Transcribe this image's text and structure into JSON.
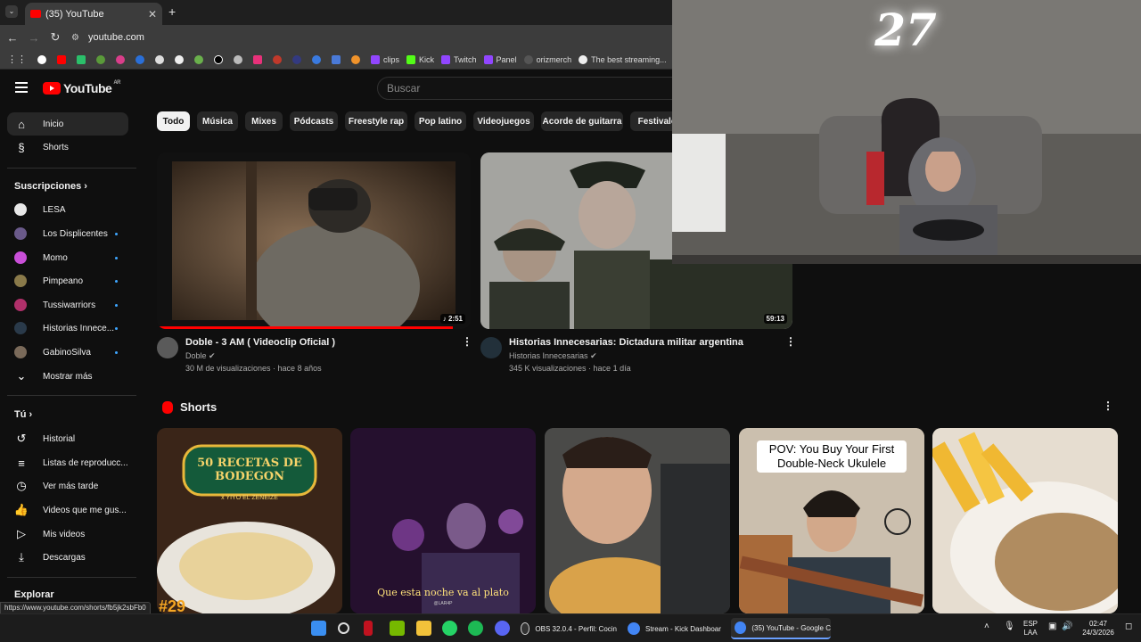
{
  "browser": {
    "tab_title": "(35) YouTube",
    "url": "youtube.com",
    "bookmarks": [
      "clips",
      "Kick",
      "Twitch",
      "Panel",
      "orizmerch",
      "The best streaming..."
    ]
  },
  "youtube": {
    "logo_text": "YouTube",
    "region": "AR",
    "search_placeholder": "Buscar",
    "chips": [
      "Todo",
      "Música",
      "Mixes",
      "Pódcasts",
      "Freestyle rap",
      "Pop latino",
      "Videojuegos",
      "Acorde de guitarra",
      "Festivale"
    ],
    "sidebar": {
      "main": [
        {
          "label": "Inicio",
          "icon": "home-icon"
        },
        {
          "label": "Shorts",
          "icon": "shorts-icon"
        }
      ],
      "subs_title": "Suscripciones",
      "subs": [
        {
          "label": "LESA",
          "color": "#e8e8e8",
          "dot": false
        },
        {
          "label": "Los Displicentes",
          "color": "#6a5a8a",
          "dot": true
        },
        {
          "label": "Momo",
          "color": "#c94fd8",
          "dot": true
        },
        {
          "label": "Pimpeano",
          "color": "#8a7a4a",
          "dot": true
        },
        {
          "label": "Tussiwarriors",
          "color": "#b0306a",
          "dot": true
        },
        {
          "label": "Historias Innece...",
          "color": "#2a3a4a",
          "dot": true
        },
        {
          "label": "GabinoSilva",
          "color": "#7a6a5a",
          "dot": true
        }
      ],
      "show_more": "Mostrar más",
      "you_title": "Tú",
      "you": [
        {
          "label": "Historial",
          "icon": "history-icon"
        },
        {
          "label": "Listas de reproducc...",
          "icon": "playlists-icon"
        },
        {
          "label": "Ver más tarde",
          "icon": "watch-later-icon"
        },
        {
          "label": "Videos que me gus...",
          "icon": "thumbs-up-icon"
        },
        {
          "label": "Mis videos",
          "icon": "my-videos-icon"
        },
        {
          "label": "Descargas",
          "icon": "download-icon"
        }
      ],
      "explore_title": "Explorar"
    },
    "videos": [
      {
        "title": "Doble - 3 AM ( Videoclip Oficial )",
        "channel": "Doble",
        "meta": "30 M de visualizaciones · hace 8 años",
        "duration": "2:51",
        "verified": true
      },
      {
        "title": "Historias Innecesarias: Dictadura militar argentina",
        "channel": "Historias Innecesarias",
        "meta": "345 K visualizaciones · hace 1 día",
        "duration": "59:13",
        "verified": true
      }
    ],
    "shorts_title": "Shorts",
    "shorts": [
      {
        "caption": "50 RECETAS DE BODEGON",
        "sub": "x YIYO EL ZENEIZE",
        "badge": "#29"
      },
      {
        "caption": "Que esta noche va al plato",
        "sub": "@LAR4P"
      },
      {
        "caption": ""
      },
      {
        "caption": "POV: You Buy Your First Double-Neck Ukulele"
      },
      {
        "caption": ""
      }
    ]
  },
  "webcam": {
    "logo": "27"
  },
  "status_url": "https://www.youtube.com/shorts/fb5jk2sbFb0",
  "taskbar": {
    "apps": [
      "OBS 32.0.4 - Perfil: Cocin",
      "Stream - Kick Dashboar",
      "(35) YouTube - Google C"
    ],
    "lang": "ESP",
    "lang2": "LAA",
    "time": "02:47",
    "date": "24/3/2026"
  }
}
